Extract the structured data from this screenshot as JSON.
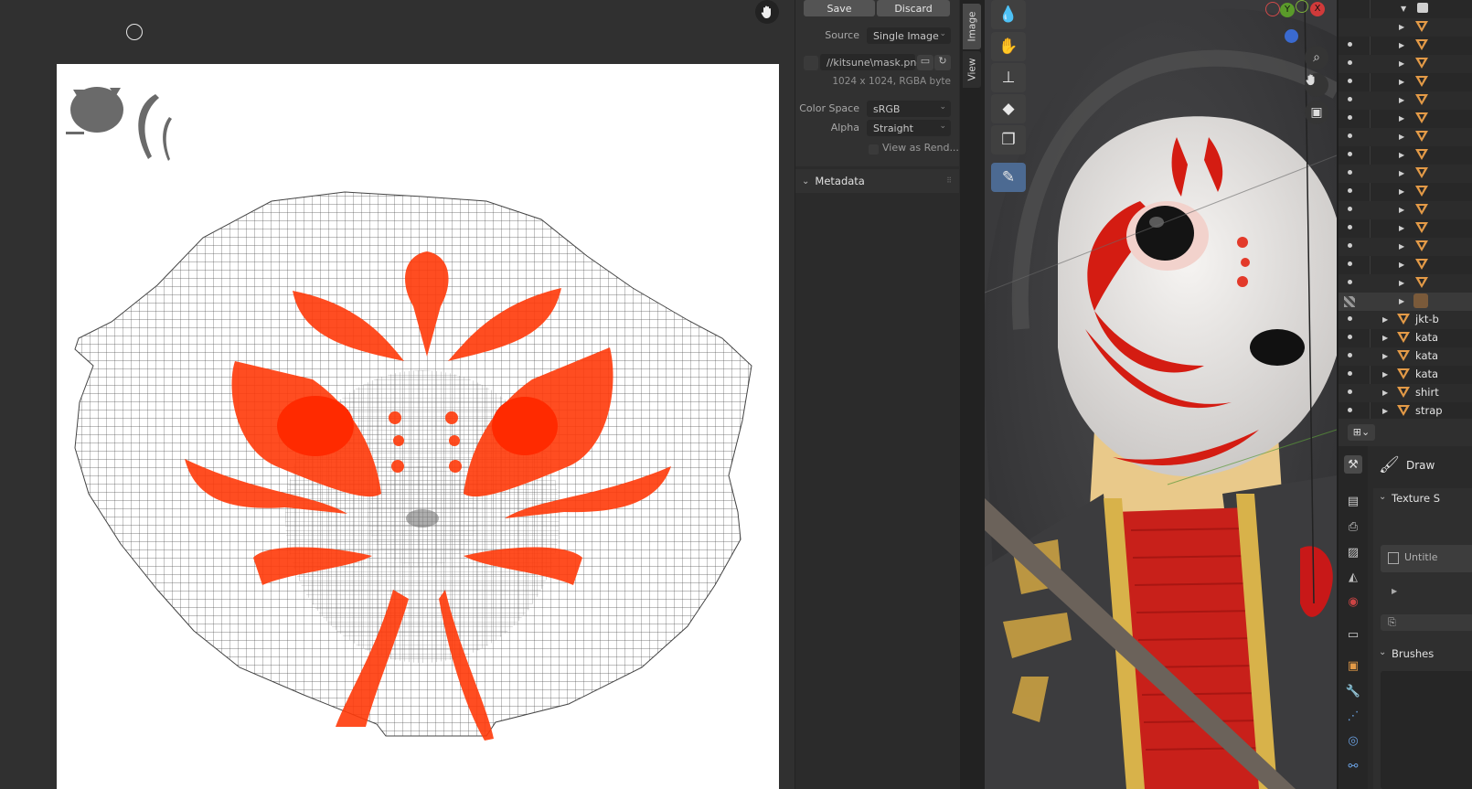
{
  "image_panel": {
    "save_label": "Save",
    "discard_label": "Discard",
    "source_label": "Source",
    "source_value": "Single Image",
    "filepath": "//kitsune\\mask.png",
    "image_info": "1024 x 1024,  RGBA byte",
    "color_space_label": "Color Space",
    "color_space_value": "sRGB",
    "alpha_label": "Alpha",
    "alpha_value": "Straight",
    "view_as_render_label": "View as Rend...",
    "metadata_label": "Metadata"
  },
  "sidebar_tabs": {
    "image_tab": "Image",
    "view_tab": "View"
  },
  "gizmo": {
    "y_label": "Y",
    "x_label": "X"
  },
  "outliner": {
    "items": [
      {
        "name": "jkt-b"
      },
      {
        "name": "kata"
      },
      {
        "name": "kata"
      },
      {
        "name": "kata"
      },
      {
        "name": "shirt"
      },
      {
        "name": "strap"
      }
    ]
  },
  "properties": {
    "draw_label": "Draw",
    "texture_slots_label": "Texture S",
    "untitled_label": "Untitle",
    "brushes_label": "Brushes"
  },
  "colors": {
    "paint_red": "#ff3a0a",
    "uv_gray": "#555555",
    "active_tool": "#4c6a92",
    "mesh_orange": "#e39a47"
  },
  "icons": {
    "hand": "hand-pan-icon",
    "zoom": "zoom-icon",
    "camera": "camera-icon",
    "brush": "brush-icon"
  }
}
